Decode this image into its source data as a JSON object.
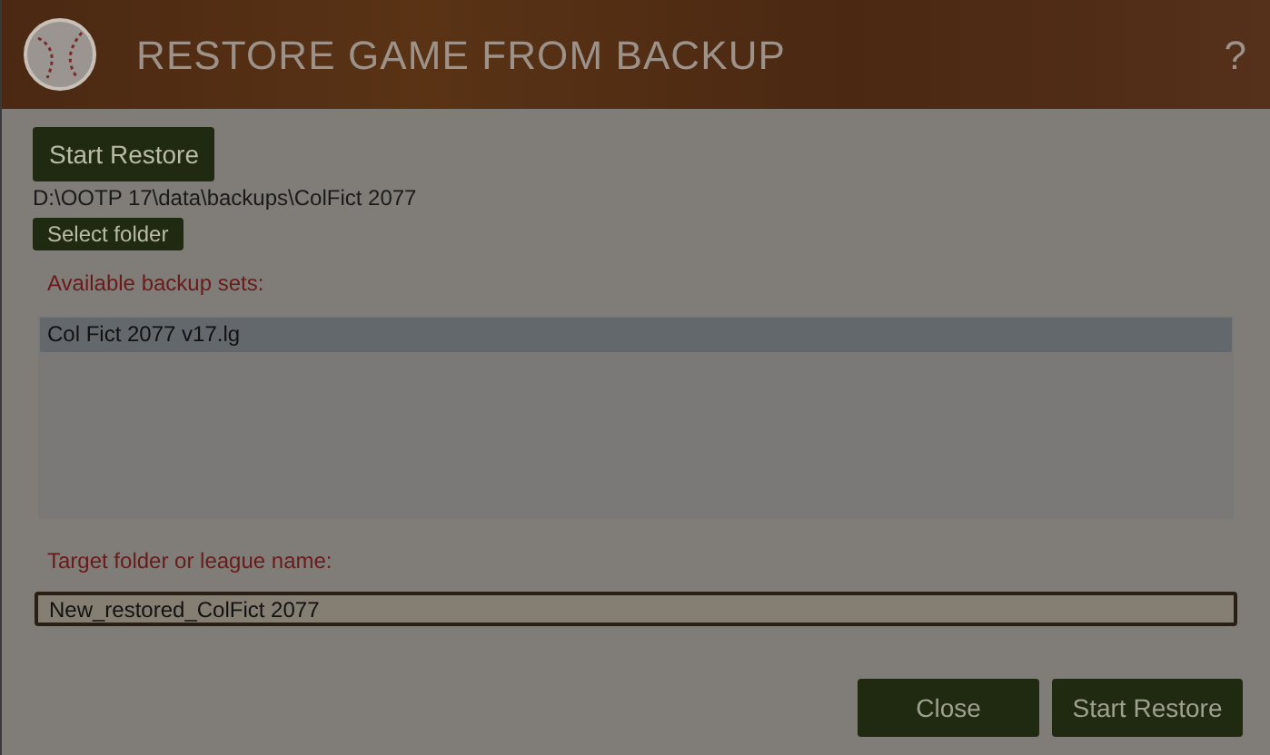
{
  "window": {
    "title": "RESTORE GAME FROM BACKUP",
    "help": "?"
  },
  "floating_button": "Start Restore",
  "path": "D:\\OOTP 17\\data\\backups\\ColFict 2077",
  "select_folder": "Select folder",
  "backup_label": "Available backup sets:",
  "backups": [
    {
      "name": "Col Fict 2077 v17.lg",
      "selected": true
    }
  ],
  "target_label": "Target folder or league name:",
  "target": {
    "value": "New_restored_ColFict 2077"
  },
  "buttons": [
    "Close",
    "Start Restore"
  ]
}
